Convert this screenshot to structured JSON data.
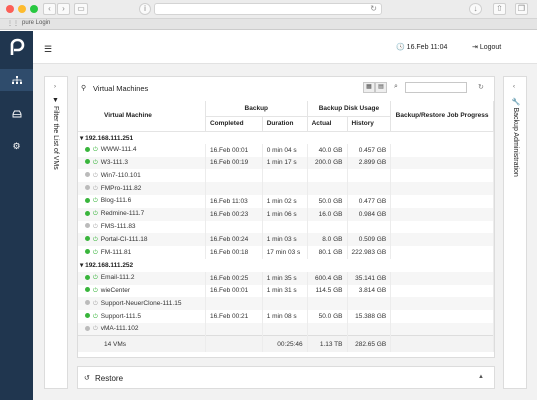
{
  "browser": {
    "tab_title": "pure Login"
  },
  "header": {
    "clock": "16.Feb 11:04",
    "logout_label": "Logout"
  },
  "side_panels": {
    "left": "Filter the List of VMs",
    "right": "Backup Administration"
  },
  "main": {
    "title": "Virtual Machines",
    "search": {
      "placeholder": "",
      "value": ""
    },
    "columns": {
      "vm": "Virtual Machine",
      "backup": "Backup",
      "completed": "Completed",
      "duration": "Duration",
      "usage": "Backup Disk Usage",
      "actual": "Actual",
      "history": "History",
      "job_progress": "Backup/Restore Job Progress"
    },
    "rows": [
      {
        "type": "group",
        "name": "192.168.111.251"
      },
      {
        "type": "vm",
        "status": "ok",
        "power": "on",
        "name": "WWW-111.4",
        "completed": "16.Feb 00:01",
        "duration": "0 min 04 s",
        "actual": "40.0 GB",
        "history": "0.457 GB"
      },
      {
        "type": "vm",
        "status": "ok",
        "power": "on",
        "name": "W3-111.3",
        "completed": "16.Feb 00:19",
        "duration": "1 min 17 s",
        "actual": "200.0 GB",
        "history": "2.899 GB"
      },
      {
        "type": "vm",
        "status": "grey",
        "power": "off",
        "name": "Win7-110.101",
        "completed": "",
        "duration": "",
        "actual": "",
        "history": ""
      },
      {
        "type": "vm",
        "status": "grey",
        "power": "off",
        "name": "FMPro-111.82",
        "completed": "",
        "duration": "",
        "actual": "",
        "history": ""
      },
      {
        "type": "vm",
        "status": "ok",
        "power": "on",
        "name": "Blog-111.6",
        "completed": "16.Feb 11:03",
        "duration": "1 min 02 s",
        "actual": "50.0 GB",
        "history": "0.477 GB"
      },
      {
        "type": "vm",
        "status": "ok",
        "power": "on",
        "name": "Redmine-111.7",
        "completed": "16.Feb 00:23",
        "duration": "1 min 06 s",
        "actual": "16.0 GB",
        "history": "0.984 GB"
      },
      {
        "type": "vm",
        "status": "grey",
        "power": "off",
        "name": "FMS-111.83",
        "completed": "",
        "duration": "",
        "actual": "",
        "history": ""
      },
      {
        "type": "vm",
        "status": "ok",
        "power": "on",
        "name": "Portal-CI-111.18",
        "completed": "16.Feb 00:24",
        "duration": "1 min 03 s",
        "actual": "8.0 GB",
        "history": "0.509 GB"
      },
      {
        "type": "vm",
        "status": "ok",
        "power": "on",
        "name": "FM-111.81",
        "completed": "16.Feb 00:18",
        "duration": "17 min 03 s",
        "actual": "80.1 GB",
        "history": "222.983 GB"
      },
      {
        "type": "group",
        "name": "192.168.111.252"
      },
      {
        "type": "vm",
        "status": "ok",
        "power": "on",
        "name": "Email-111.2",
        "completed": "16.Feb 00:25",
        "duration": "1 min 35 s",
        "actual": "600.4 GB",
        "history": "35.141 GB"
      },
      {
        "type": "vm",
        "status": "ok",
        "power": "on",
        "name": "wieCenter",
        "completed": "16.Feb 00:01",
        "duration": "1 min 31 s",
        "actual": "114.5 GB",
        "history": "3.814 GB"
      },
      {
        "type": "vm",
        "status": "grey",
        "power": "off",
        "name": "Support-NeuerClone-111.15",
        "completed": "",
        "duration": "",
        "actual": "",
        "history": ""
      },
      {
        "type": "vm",
        "status": "ok",
        "power": "on",
        "name": "Support-111.5",
        "completed": "16.Feb 00:21",
        "duration": "1 min 08 s",
        "actual": "50.0 GB",
        "history": "15.388 GB"
      },
      {
        "type": "vm",
        "status": "grey",
        "power": "off",
        "name": "vMA-111.102",
        "completed": "",
        "duration": "",
        "actual": "",
        "history": ""
      }
    ],
    "footer": {
      "count": "14 VMs",
      "duration": "00:25:46",
      "actual": "1.13 TB",
      "history": "282.65 GB"
    }
  },
  "restore": {
    "label": "Restore"
  },
  "colors": {
    "sidebar": "#20364f",
    "status_ok": "#39b53c",
    "status_off": "#bbbbbb"
  }
}
